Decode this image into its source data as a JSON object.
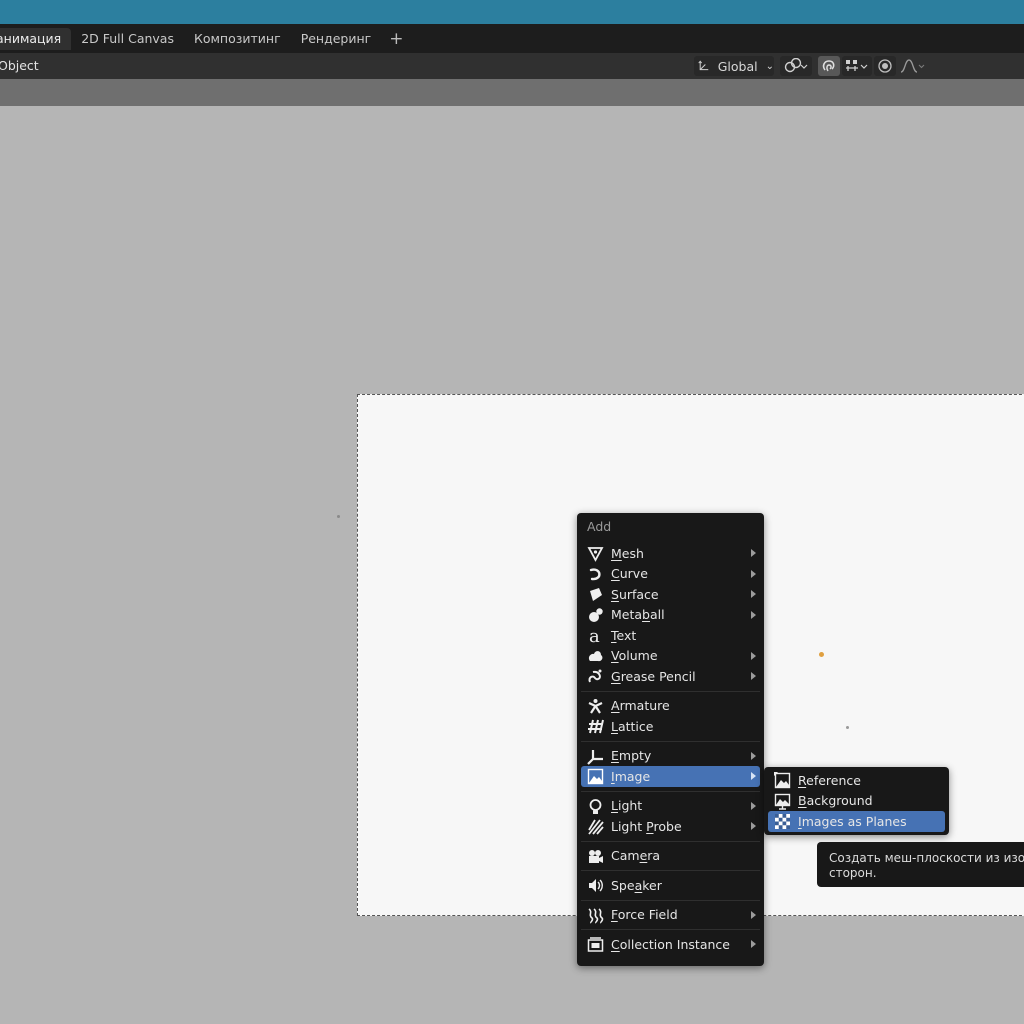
{
  "tabs": [
    {
      "label": "анимация",
      "active": true
    },
    {
      "label": "2D Full Canvas"
    },
    {
      "label": "Композитинг"
    },
    {
      "label": "Рендеринг"
    }
  ],
  "header": {
    "object_label": "Object",
    "orientation": "Global"
  },
  "add_menu": {
    "title": "Add",
    "groups": [
      [
        {
          "label": "Mesh",
          "icon": "mesh-icon",
          "submenu": true,
          "ul": 0
        },
        {
          "label": "Curve",
          "icon": "curve-icon",
          "submenu": true,
          "ul": 0
        },
        {
          "label": "Surface",
          "icon": "surface-icon",
          "submenu": true,
          "ul": 0
        },
        {
          "label": "Metaball",
          "icon": "metaball-icon",
          "submenu": true,
          "ul": 4
        },
        {
          "label": "Text",
          "icon": "text-icon",
          "submenu": false,
          "ul": 0
        },
        {
          "label": "Volume",
          "icon": "volume-icon",
          "submenu": true,
          "ul": 0
        },
        {
          "label": "Grease Pencil",
          "icon": "grease-pencil-icon",
          "submenu": true,
          "ul": 0
        }
      ],
      [
        {
          "label": "Armature",
          "icon": "armature-icon",
          "submenu": false,
          "ul": 0
        },
        {
          "label": "Lattice",
          "icon": "lattice-icon",
          "submenu": false,
          "ul": 0
        }
      ],
      [
        {
          "label": "Empty",
          "icon": "empty-icon",
          "submenu": true,
          "ul": 0
        },
        {
          "label": "Image",
          "icon": "image-icon",
          "submenu": true,
          "ul": 0,
          "highlighted": true
        }
      ],
      [
        {
          "label": "Light",
          "icon": "light-icon",
          "submenu": true,
          "ul": 0
        },
        {
          "label": "Light Probe",
          "icon": "light-probe-icon",
          "submenu": true,
          "ul": 6
        }
      ],
      [
        {
          "label": "Camera",
          "icon": "camera-icon",
          "submenu": false,
          "ul": 3
        }
      ],
      [
        {
          "label": "Speaker",
          "icon": "speaker-icon",
          "submenu": false,
          "ul": 3
        }
      ],
      [
        {
          "label": "Force Field",
          "icon": "force-field-icon",
          "submenu": true,
          "ul": 0
        }
      ],
      [
        {
          "label": "Collection Instance",
          "icon": "collection-instance-icon",
          "submenu": true,
          "ul": 0
        }
      ]
    ]
  },
  "image_submenu": [
    {
      "label": "Reference",
      "icon": "reference-image-icon",
      "ul": 0
    },
    {
      "label": "Background",
      "icon": "background-image-icon",
      "ul": 0
    },
    {
      "label": "Images as Planes",
      "icon": "images-as-planes-icon",
      "ul": 0,
      "highlighted": true
    }
  ],
  "tooltip": {
    "line1": "Создать меш-плоскости из изобр",
    "line2": "сторон."
  },
  "colors": {
    "title_bar": "#2c7f9f",
    "highlight": "#4672b4",
    "menu_bg": "#181818",
    "viewport": "#b5b5b5"
  }
}
